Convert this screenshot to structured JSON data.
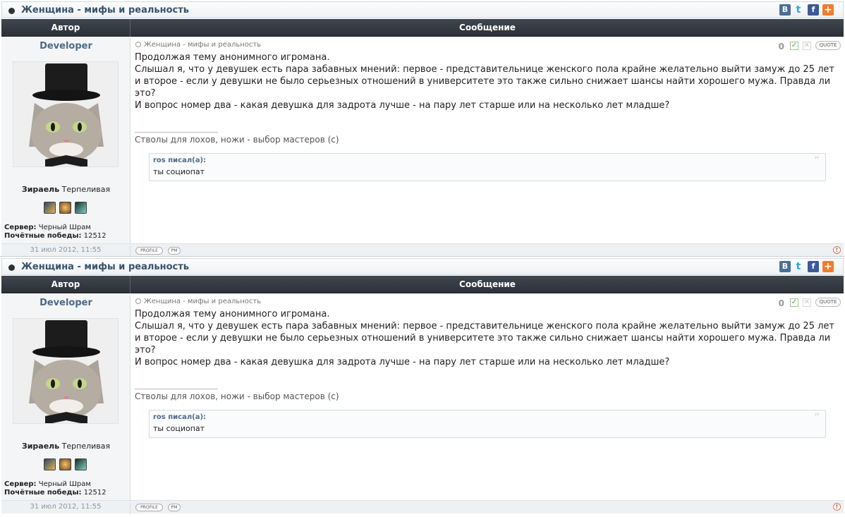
{
  "posts": [
    {
      "topic_title": "Женщина - мифы и реальность",
      "share": {
        "vk": "B",
        "twitter": "t",
        "facebook": "f",
        "plus": "+"
      },
      "header": {
        "author_col": "Автор",
        "message_col": "Сообщение"
      },
      "author": {
        "name": "Developer",
        "rank_name": "Зираель",
        "rank_title": "Терпеливая",
        "server_label": "Сервер:",
        "server_value": "Черный Шрам",
        "wins_label": "Почётные победы:",
        "wins_value": "12512"
      },
      "subject": "Женщина - мифы и реальность",
      "reputation": "0",
      "quote_button": "QUOTE",
      "body_lines": [
        "Продолжая тему анонимного игромана.",
        "Слышал я, что у девушек есть пара забавных мнений: первое - представительнице женского пола крайне желательно выйти замуж до 25 лет и второе - если у девушки не было серьезных отношений в университете это также сильно снижает шансы найти хорошего мужа. Правда ли это?",
        "И вопрос номер два - какая девушка для задрота лучше - на пару лет старше или на несколько лет младше?"
      ],
      "signature": "Стволы для лохов, ножи - выбор мастеров (с)",
      "quote": {
        "author": "ros писал(а):",
        "text": "ты социопат"
      },
      "date": "31 июл 2012, 11:55",
      "footer": {
        "profile": "PROFILE",
        "pm": "PM",
        "report": "!"
      }
    },
    {
      "topic_title": "Женщина - мифы и реальность",
      "share": {
        "vk": "B",
        "twitter": "t",
        "facebook": "f",
        "plus": "+"
      },
      "header": {
        "author_col": "Автор",
        "message_col": "Сообщение"
      },
      "author": {
        "name": "Developer",
        "rank_name": "Зираель",
        "rank_title": "Терпеливая",
        "server_label": "Сервер:",
        "server_value": "Черный Шрам",
        "wins_label": "Почётные победы:",
        "wins_value": "12512"
      },
      "subject": "Женщина - мифы и реальность",
      "reputation": "0",
      "quote_button": "QUOTE",
      "body_lines": [
        "Продолжая тему анонимного игромана.",
        "Слышал я, что у девушек есть пара забавных мнений: первое - представительнице женского пола крайне желательно выйти замуж до 25 лет и второе - если у девушки не было серьезных отношений в университете это также сильно снижает шансы найти хорошего мужа. Правда ли это?",
        "И вопрос номер два - какая девушка для задрота лучше - на пару лет старше или на несколько лет младше?"
      ],
      "signature": "Стволы для лохов, ножи - выбор мастеров (с)",
      "quote": {
        "author": "ros писал(а):",
        "text": "ты социопат"
      },
      "date": "31 июл 2012, 11:55",
      "footer": {
        "profile": "PROFILE",
        "pm": "PM",
        "report": "!"
      }
    }
  ]
}
